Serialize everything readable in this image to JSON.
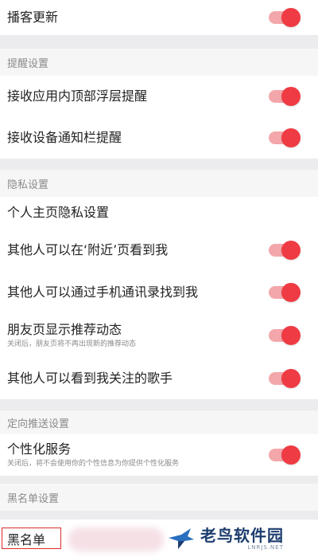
{
  "top_row": {
    "label": "播客更新",
    "on": true
  },
  "reminder": {
    "header": "提醒设置",
    "items": [
      {
        "label": "接收应用内顶部浮层提醒",
        "on": true
      },
      {
        "label": "接收设备通知栏提醒",
        "on": true
      }
    ]
  },
  "privacy": {
    "header": "隐私设置",
    "homepage": {
      "label": "个人主页隐私设置"
    },
    "items": [
      {
        "label": "其他人可以在‘附近’页看到我",
        "on": true
      },
      {
        "label": "其他人可以通过手机通讯录找到我",
        "on": true
      },
      {
        "label": "朋友页显示推荐动态",
        "sub": "关闭后，朋友页将不再出现新的推荐动态",
        "on": true
      },
      {
        "label": "其他人可以看到我关注的歌手",
        "on": true
      }
    ]
  },
  "push": {
    "header": "定向推送设置",
    "item": {
      "label": "个性化服务",
      "sub": "关闭后，将不会使用你的个性信息为你提供个性化服务",
      "on": true
    }
  },
  "blacklist": {
    "header": "黑名单设置",
    "item_label": "黑名单"
  },
  "watermark": {
    "title": "老鸟软件园",
    "url": "LNRJS.NET"
  },
  "colors": {
    "accent": "#ef3b43",
    "track": "#f3a7aa"
  }
}
